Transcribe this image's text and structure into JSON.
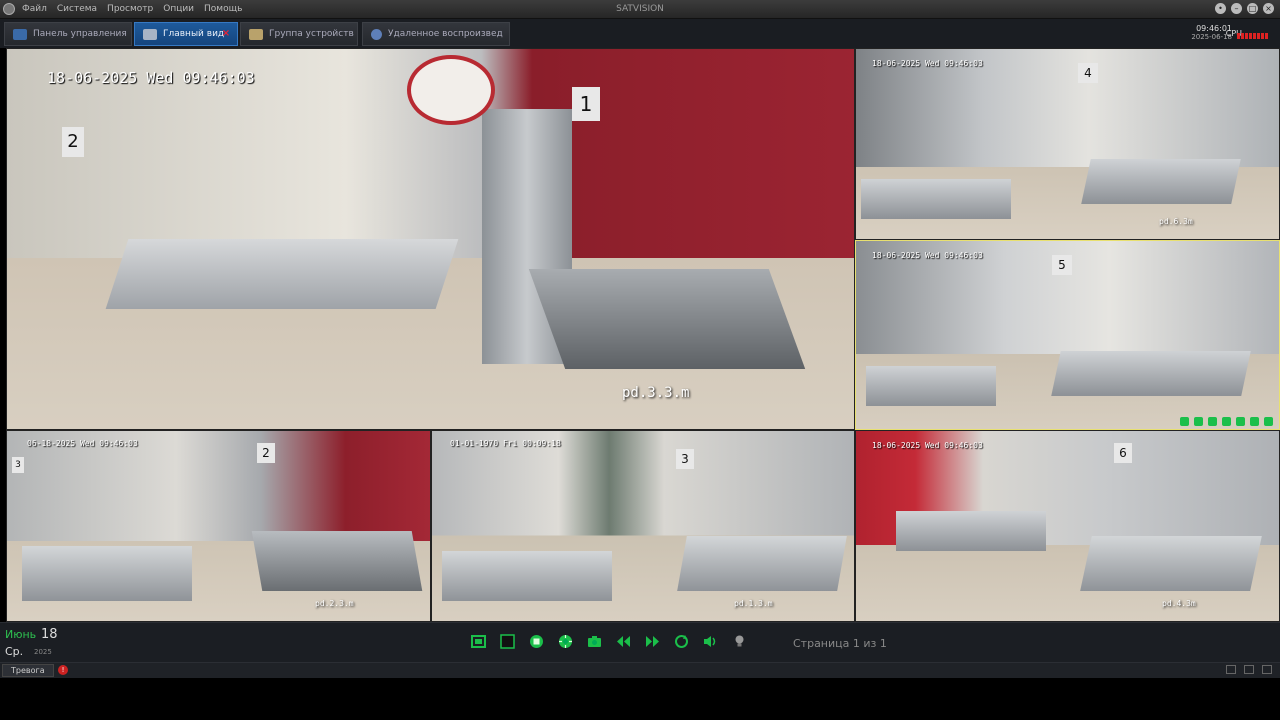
{
  "app": {
    "title": "SATVISION",
    "menu": [
      "Файл",
      "Система",
      "Просмотр",
      "Опции",
      "Помощь"
    ]
  },
  "tabs": [
    {
      "label": "Панель управления",
      "icon": "control-panel-icon"
    },
    {
      "label": "Главный вид",
      "icon": "monitor-icon",
      "active": true
    },
    {
      "label": "Группа устройств",
      "icon": "device-group-icon"
    },
    {
      "label": "Удаленное воспроизвед",
      "icon": "playback-icon"
    }
  ],
  "status": {
    "time": "09:46:01",
    "date": "2025-06-18",
    "cpu_label": "CPU"
  },
  "cameras": [
    {
      "id": 1,
      "timestamp": "18-06-2025 Wed 09:46:03",
      "number": "1",
      "label": "pd.3.3.m",
      "extra_number": "2"
    },
    {
      "id": 2,
      "timestamp": "18-06-2025 Wed 09:46:03",
      "number": "4",
      "label": "pd.6.3m"
    },
    {
      "id": 3,
      "timestamp": "18-06-2025 Wed 09:46:03",
      "number": "5",
      "label": ""
    },
    {
      "id": 4,
      "timestamp": "06-18-2025 Wed 09:46:03",
      "number": "2",
      "label": "pd.2.3.m",
      "extra_number": "3"
    },
    {
      "id": 5,
      "timestamp": "01-01-1970 Fri 00:09:18",
      "number": "3",
      "label": "pd.1.3.m"
    },
    {
      "id": 6,
      "timestamp": "18-06-2025 Wed 09:46:03",
      "number": "6",
      "label": "pd.4.3m"
    }
  ],
  "date_panel": {
    "month": "Июнь",
    "day": "18",
    "weekday": "Ср.",
    "year": "2025"
  },
  "toolbar": {
    "icons": [
      "fullscreen-icon",
      "stop-square-icon",
      "record-icon",
      "ptz-icon",
      "snapshot-icon",
      "rewind-icon",
      "forward-icon",
      "refresh-icon",
      "audio-icon",
      "light-icon"
    ]
  },
  "page_info": "Страница 1 из 1",
  "alarm": {
    "tab_label": "Тревога"
  },
  "colors": {
    "accent_tab": "#1e5a9c",
    "green_tool": "#1bbf4a",
    "selected_border": "#e8e070"
  }
}
